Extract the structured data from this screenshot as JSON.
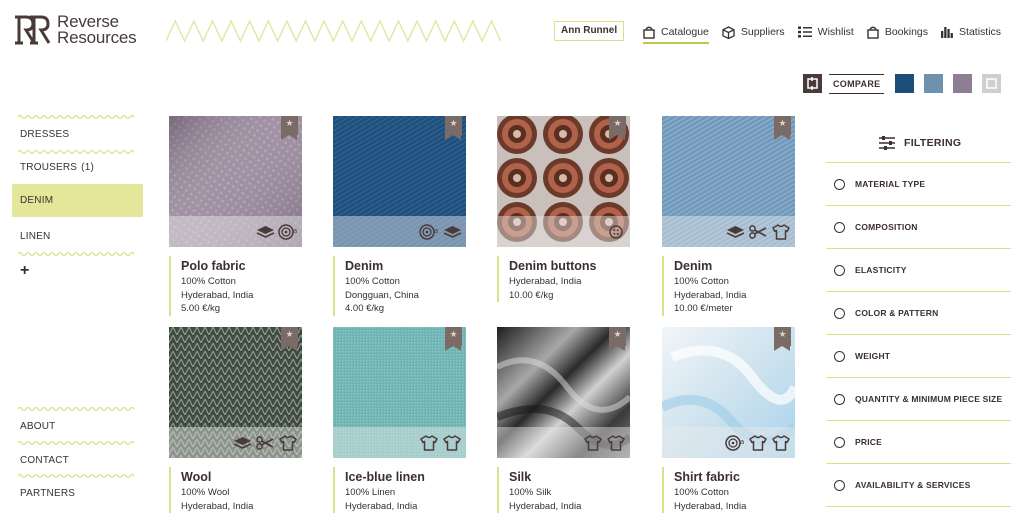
{
  "brand": {
    "name_line1": "Reverse",
    "name_line2": "Resources"
  },
  "user": {
    "name": "Ann Runnel"
  },
  "nav": [
    {
      "label": "Catalogue",
      "icon": "bag-icon",
      "active": true
    },
    {
      "label": "Suppliers",
      "icon": "box-icon",
      "active": false
    },
    {
      "label": "Wishlist",
      "icon": "list-icon",
      "active": false
    },
    {
      "label": "Bookings",
      "icon": "bag-icon",
      "active": false
    },
    {
      "label": "Statistics",
      "icon": "bar-chart-icon",
      "active": false
    }
  ],
  "compare": {
    "label": "COMPARE",
    "swatch_colors": [
      "#1f4d7a",
      "#6e92ad",
      "#8f7e93",
      "#cfcfcf"
    ]
  },
  "categories": [
    {
      "label": "DRESSES",
      "active": false
    },
    {
      "label": "TROUSERS",
      "count": "(1)",
      "active": false
    },
    {
      "label": "DENIM",
      "active": true
    },
    {
      "label": "LINEN",
      "active": false
    }
  ],
  "add_category": "+",
  "footer_links": [
    "ABOUT",
    "CONTACT",
    "PARTNERS"
  ],
  "products": [
    {
      "name": "Polo fabric",
      "lines": [
        "100% Cotton",
        "Hyderabad, India",
        "5.00 €/kg"
      ],
      "icons": [
        "stack-icon",
        "roll-icon"
      ]
    },
    {
      "name": "Denim",
      "lines": [
        "100% Cotton",
        "Dongguan, China",
        "4.00 €/kg"
      ],
      "icons": [
        "roll-icon",
        "stack-icon"
      ]
    },
    {
      "name": "Denim buttons",
      "lines": [
        "Hyderabad, India",
        "10.00 €/kg"
      ],
      "icons": [
        "button-icon"
      ]
    },
    {
      "name": "Denim",
      "lines": [
        "100% Cotton",
        "Hyderabad, India",
        "10.00 €/meter"
      ],
      "icons": [
        "stack-icon",
        "scissors-icon",
        "shirt-icon"
      ]
    },
    {
      "name": "Wool",
      "lines": [
        "100% Wool",
        "Hyderabad, India"
      ],
      "icons": [
        "stack-icon",
        "scissors-icon",
        "shirt-icon"
      ]
    },
    {
      "name": "Ice-blue linen",
      "lines": [
        "100% Linen",
        "Hyderabad, India"
      ],
      "icons": [
        "shirt-icon",
        "shirt-icon"
      ]
    },
    {
      "name": "Silk",
      "lines": [
        "100% Silk",
        "Hyderabad, India"
      ],
      "icons": [
        "shirt-icon",
        "shirt-icon"
      ]
    },
    {
      "name": "Shirt fabric",
      "lines": [
        "100% Cotton",
        "Hyderabad, India"
      ],
      "icons": [
        "roll-icon",
        "shirt-icon",
        "shirt-icon"
      ]
    }
  ],
  "filter": {
    "title": "FILTERING",
    "options": [
      "MATERIAL TYPE",
      "COMPOSITION",
      "ELASTICITY",
      "COLOR & PATTERN",
      "WEIGHT",
      "QUANTITY & MINIMUM PIECE SIZE",
      "PRICE",
      "AVAILABILITY & SERVICES"
    ]
  }
}
